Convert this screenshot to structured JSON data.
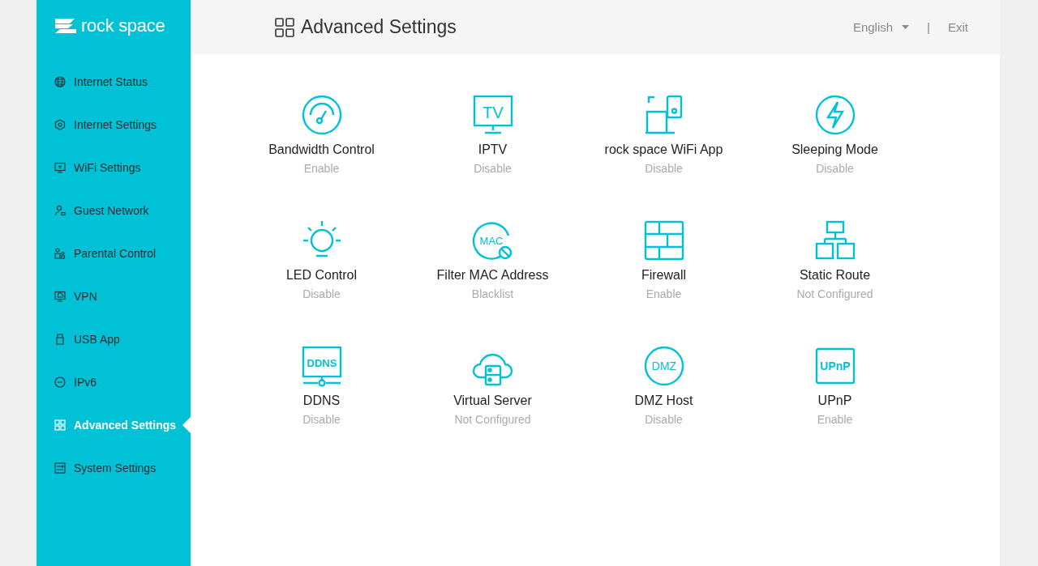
{
  "logo": {
    "text": "rock space"
  },
  "sidebar": {
    "items": [
      {
        "label": "Internet Status",
        "kind": "globe",
        "selected": false
      },
      {
        "label": "Internet Settings",
        "kind": "hexagon",
        "selected": false
      },
      {
        "label": "WiFi Settings",
        "kind": "wifi",
        "selected": false
      },
      {
        "label": "Guest Network",
        "kind": "person",
        "selected": false
      },
      {
        "label": "Parental Control",
        "kind": "family",
        "selected": false
      },
      {
        "label": "VPN",
        "kind": "vpn",
        "selected": false
      },
      {
        "label": "USB App",
        "kind": "usb",
        "selected": false
      },
      {
        "label": "IPv6",
        "kind": "badge",
        "selected": false
      },
      {
        "label": "Advanced Settings",
        "kind": "grid",
        "selected": true
      },
      {
        "label": "System Settings",
        "kind": "panel",
        "selected": false
      }
    ]
  },
  "header": {
    "title": "Advanced Settings",
    "language": "English",
    "separator": "|",
    "exit": "Exit"
  },
  "features": [
    {
      "name": "Bandwidth Control",
      "status": "Enable",
      "kind": "gauge"
    },
    {
      "name": "IPTV",
      "status": "Disable",
      "kind": "tv",
      "icon_text": "TV"
    },
    {
      "name": "rock space WiFi App",
      "status": "Disable",
      "kind": "app"
    },
    {
      "name": "Sleeping Mode",
      "status": "Disable",
      "kind": "bolt"
    },
    {
      "name": "LED Control",
      "status": "Disable",
      "kind": "bulb"
    },
    {
      "name": "Filter MAC Address",
      "status": "Blacklist",
      "kind": "blocked-circle",
      "icon_text": "MAC"
    },
    {
      "name": "Firewall",
      "status": "Enable",
      "kind": "wall"
    },
    {
      "name": "Static Route",
      "status": "Not Configured",
      "kind": "tree"
    },
    {
      "name": "DDNS",
      "status": "Disable",
      "kind": "monitor",
      "icon_text": "DDNS"
    },
    {
      "name": "Virtual Server",
      "status": "Not Configured",
      "kind": "cloud"
    },
    {
      "name": "DMZ Host",
      "status": "Disable",
      "kind": "circle",
      "icon_text": "DMZ"
    },
    {
      "name": "UPnP",
      "status": "Enable",
      "kind": "box",
      "icon_text": "UPnP"
    }
  ]
}
